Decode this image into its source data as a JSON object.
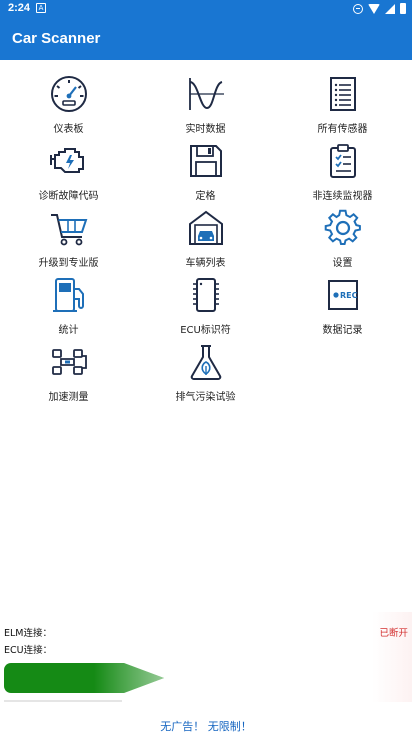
{
  "status_bar": {
    "time": "2:24",
    "notification_icon": "a-icon"
  },
  "app_bar": {
    "title": "Car Scanner"
  },
  "menu": [
    {
      "label": "仪表板",
      "icon": "gauge-icon"
    },
    {
      "label": "实时数据",
      "icon": "waveform-icon"
    },
    {
      "label": "所有传感器",
      "icon": "list-icon"
    },
    {
      "label": "诊断故障代码",
      "icon": "engine-icon"
    },
    {
      "label": "定格",
      "icon": "floppy-icon"
    },
    {
      "label": "非连续监视器",
      "icon": "clipboard-check-icon"
    },
    {
      "label": "升级到专业版",
      "icon": "cart-icon"
    },
    {
      "label": "车辆列表",
      "icon": "garage-icon"
    },
    {
      "label": "设置",
      "icon": "gear-icon"
    },
    {
      "label": "统计",
      "icon": "fuel-pump-icon"
    },
    {
      "label": "ECU标识符",
      "icon": "chip-icon"
    },
    {
      "label": "数据记录",
      "icon": "rec-icon"
    },
    {
      "label": "加速测量",
      "icon": "race-car-icon"
    },
    {
      "label": "排气污染试验",
      "icon": "flask-icon"
    }
  ],
  "connection": {
    "elm_label": "ELM连接：",
    "ecu_label": "ECU连接：",
    "status": "已断开",
    "status_color": "#d32f2f"
  },
  "promo": {
    "text": "无广告！ 无限制！"
  },
  "colors": {
    "primary": "#1976d2",
    "icon_stroke": "#1f2a44",
    "icon_accent": "#1e6fb8",
    "progress": "#158a15"
  }
}
